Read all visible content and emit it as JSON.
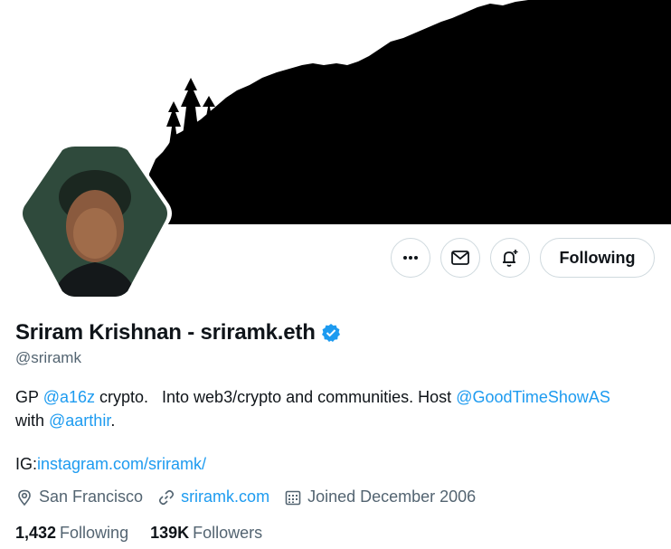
{
  "profile": {
    "name": "Sriram Krishnan - sriramk.eth",
    "handle": "@sriramk",
    "bio": {
      "part1": "GP ",
      "mention1": "@a16z",
      "part2": " crypto.   Into web3/crypto and communities. Host ",
      "mention2": "@GoodTimeShowAS",
      "part3": "with ",
      "mention3": "@aarthir",
      "part4": ".",
      "ig_label": "IG:",
      "ig_link": "instagram.com/sriramk/"
    },
    "location": "San Francisco",
    "website": "sriramk.com",
    "joined": "Joined December 2006",
    "following_count": "1,432",
    "following_label": "Following",
    "followers_count": "139K",
    "followers_label": "Followers"
  },
  "actions": {
    "more_icon": "more-horizontal-icon",
    "message_icon": "mail-icon",
    "notify_icon": "bell-plus-icon",
    "follow_label": "Following"
  },
  "colors": {
    "accent": "#1d9bf0",
    "text": "#0f1419",
    "secondary": "#536471",
    "border": "#cfd9de"
  }
}
